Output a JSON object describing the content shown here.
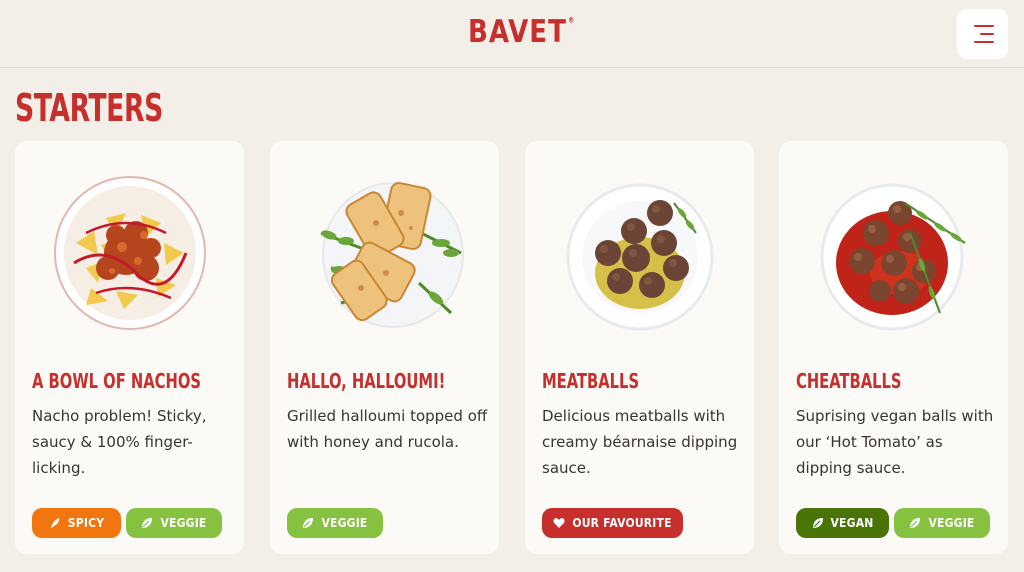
{
  "header": {
    "logo": "BAVET",
    "logo_mark": "®",
    "menu_icon": "hamburger-menu-icon"
  },
  "section": {
    "title": "STARTERS"
  },
  "cards": [
    {
      "title": "A BOWL OF NACHOS",
      "description": "Nacho problem! Sticky, saucy & 100% finger-licking.",
      "image": "nachos-dish-image",
      "tags": [
        {
          "label": "SPICY",
          "icon": "chili-icon",
          "color": "#f27610"
        },
        {
          "label": "VEGGIE",
          "icon": "leaf-icon",
          "color": "#86c23f"
        }
      ]
    },
    {
      "title": "HALLO, HALLOUMI!",
      "description": "Grilled halloumi topped off with honey and rucola.",
      "image": "halloumi-dish-image",
      "tags": [
        {
          "label": "VEGGIE",
          "icon": "leaf-icon",
          "color": "#86c23f"
        }
      ]
    },
    {
      "title": "MEATBALLS",
      "description": "Delicious meatballs with creamy béarnaise dipping sauce.",
      "image": "meatballs-dish-image",
      "tags": [
        {
          "label": "OUR FAVOURITE",
          "icon": "heart-icon",
          "color": "#c62f2c"
        }
      ]
    },
    {
      "title": "CHEATBALLS",
      "description": "Suprising vegan balls with our ‘Hot Tomato’ as dipping sauce.",
      "image": "cheatballs-dish-image",
      "tags": [
        {
          "label": "VEGAN",
          "icon": "leaf-icon",
          "color": "#4a7408"
        },
        {
          "label": "VEGGIE",
          "icon": "leaf-icon",
          "color": "#86c23f"
        }
      ]
    }
  ],
  "colors": {
    "brand_red": "#c62f2c",
    "background": "#f3efe8",
    "card": "#fbfaf6"
  }
}
